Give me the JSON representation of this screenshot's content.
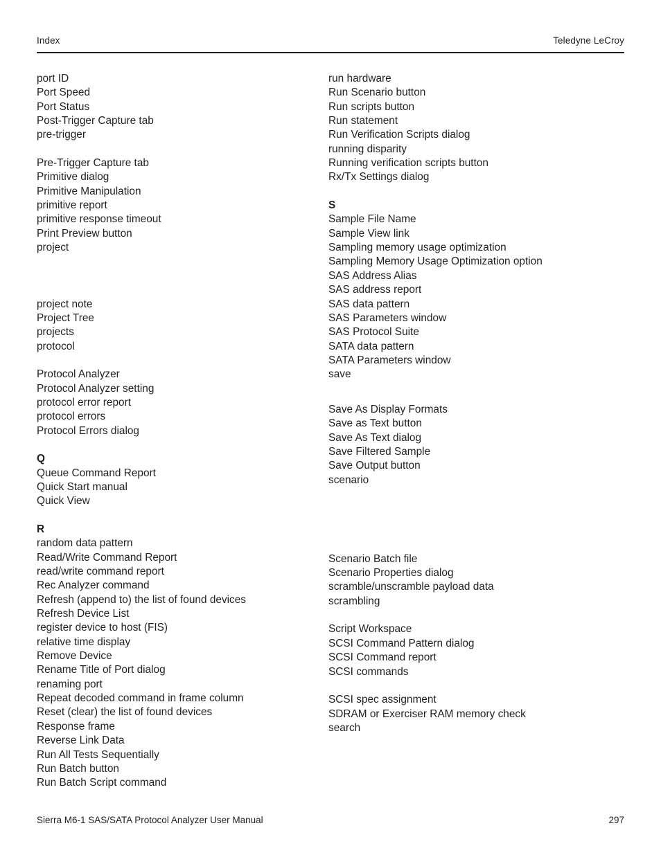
{
  "header": {
    "left": "Index",
    "right": "Teledyne LeCroy"
  },
  "footer": {
    "manual_title": "Sierra M6-1 SAS/SATA Protocol Analyzer User Manual",
    "page_number": "297"
  },
  "columns": {
    "left": [
      {
        "type": "entries",
        "items": [
          "port ID",
          "Port Speed",
          "Port Status",
          "Post-Trigger Capture tab",
          "pre-trigger"
        ]
      },
      {
        "type": "spacer",
        "lines": 1
      },
      {
        "type": "entries",
        "items": [
          "Pre-Trigger Capture tab",
          "Primitive dialog",
          "Primitive Manipulation",
          "primitive report",
          "primitive response timeout",
          "Print Preview button",
          "project"
        ]
      },
      {
        "type": "spacer",
        "lines": 3
      },
      {
        "type": "entries",
        "items": [
          "project note",
          "Project Tree",
          "projects",
          "protocol"
        ]
      },
      {
        "type": "spacer",
        "lines": 1
      },
      {
        "type": "entries",
        "items": [
          "Protocol Analyzer",
          "Protocol Analyzer setting",
          "protocol error report",
          "protocol errors",
          "Protocol Errors dialog"
        ]
      },
      {
        "type": "spacer",
        "lines": 1
      },
      {
        "type": "letter",
        "label": "Q"
      },
      {
        "type": "entries",
        "items": [
          "Queue Command Report",
          "Quick Start manual",
          "Quick View"
        ]
      },
      {
        "type": "spacer",
        "lines": 1
      },
      {
        "type": "letter",
        "label": "R"
      },
      {
        "type": "entries",
        "items": [
          "random data pattern",
          "Read/Write Command Report",
          "read/write command report",
          "Rec Analyzer command",
          "Refresh (append to) the list of found devices",
          "Refresh Device List",
          "register device to host (FIS)",
          "relative time display",
          "Remove Device",
          "Rename Title of Port dialog",
          "renaming port",
          "Repeat decoded command in frame column",
          "Reset (clear) the list of found devices",
          "Response frame",
          "Reverse Link Data",
          "Run All Tests Sequentially",
          "Run Batch button",
          "Run Batch Script command"
        ]
      }
    ],
    "right": [
      {
        "type": "entries",
        "items": [
          "run hardware",
          "Run Scenario button",
          "Run scripts button",
          "Run statement",
          "Run Verification Scripts dialog",
          "running disparity",
          "Running verification scripts button",
          "Rx/Tx Settings dialog"
        ]
      },
      {
        "type": "spacer",
        "lines": 1
      },
      {
        "type": "letter",
        "label": "S"
      },
      {
        "type": "entries",
        "items": [
          "Sample File Name",
          "Sample View link",
          "Sampling memory usage optimization",
          "Sampling Memory Usage Optimization option",
          "SAS Address Alias",
          "SAS address report",
          "SAS data pattern",
          "SAS Parameters window",
          "SAS Protocol Suite",
          "SATA data pattern",
          "SATA Parameters window",
          "save"
        ]
      },
      {
        "type": "spacer",
        "lines": 1.5
      },
      {
        "type": "entries",
        "items": [
          "Save As Display Formats",
          "Save as Text button",
          "Save As Text dialog",
          "Save Filtered Sample",
          "Save Output button",
          "scenario"
        ]
      },
      {
        "type": "spacer",
        "lines": 4.6
      },
      {
        "type": "entries",
        "items": [
          "Scenario Batch file",
          "Scenario Properties dialog",
          "scramble/unscramble payload data",
          "scrambling"
        ]
      },
      {
        "type": "spacer",
        "lines": 1
      },
      {
        "type": "entries",
        "items": [
          "Script Workspace",
          "SCSI Command Pattern dialog",
          "SCSI Command report",
          "SCSI commands"
        ]
      },
      {
        "type": "spacer",
        "lines": 1
      },
      {
        "type": "entries",
        "items": [
          "SCSI spec assignment",
          "SDRAM or Exerciser RAM memory check",
          "search"
        ]
      }
    ]
  }
}
